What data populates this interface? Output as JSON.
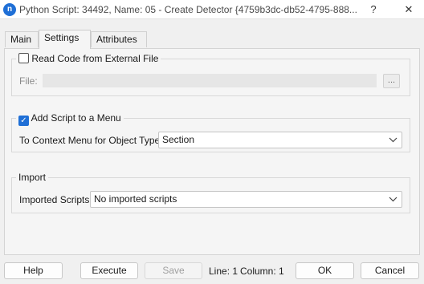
{
  "window": {
    "icon": "n",
    "title": "Python Script: 34492, Name: 05 - Create Detector  {4759b3dc-db52-4795-888...",
    "help": "?",
    "close": "✕"
  },
  "tabs": [
    {
      "label": "Main"
    },
    {
      "label": "Settings"
    },
    {
      "label": "Attributes"
    }
  ],
  "external_file": {
    "checkbox_label": "Read Code from External File",
    "checked": false,
    "file_label": "File:",
    "file_value": "",
    "browse_label": "..."
  },
  "menu": {
    "checkbox_label": "Add Script to a Menu",
    "checked": true,
    "check_mark": "✓",
    "context_label": "To Context Menu for Object Type:",
    "context_value": "Section"
  },
  "import": {
    "group_label": "Import",
    "scripts_label": "Imported Scripts:",
    "scripts_value": "No imported scripts"
  },
  "footer": {
    "help": "Help",
    "execute": "Execute",
    "save": "Save",
    "line": "Line: 1",
    "column": "Column: 1",
    "ok": "OK",
    "cancel": "Cancel"
  },
  "icons": {
    "chevron": "⌄"
  },
  "colors": {
    "accent": "#1f6fd6"
  }
}
